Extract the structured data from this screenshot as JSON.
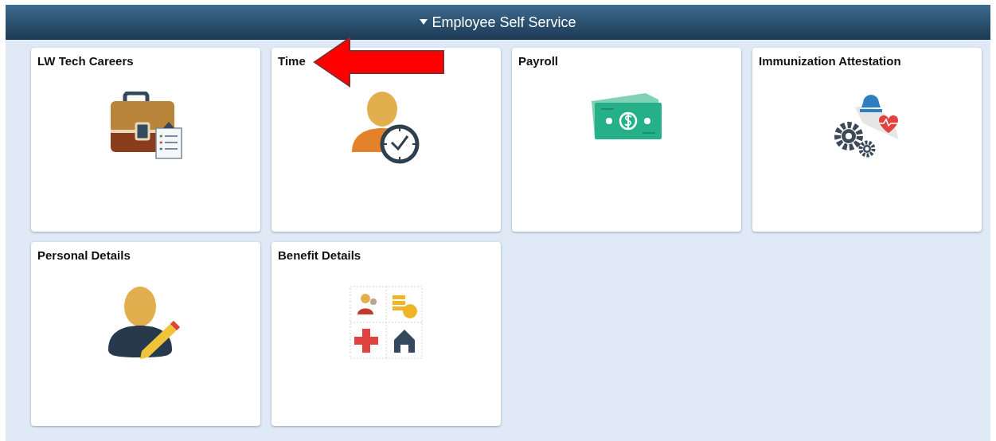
{
  "header": {
    "title": "Employee Self Service",
    "expanded": true
  },
  "tiles": [
    {
      "title": "LW Tech Careers",
      "kind": "careers",
      "marked": false
    },
    {
      "title": "Time",
      "kind": "time",
      "marked": true
    },
    {
      "title": "Payroll",
      "kind": "payroll",
      "marked": false
    },
    {
      "title": "Immunization Attestation",
      "kind": "immunization",
      "marked": false
    },
    {
      "title": "Personal Details",
      "kind": "personal",
      "marked": false
    },
    {
      "title": "Benefit Details",
      "kind": "benefits",
      "marked": false
    }
  ]
}
